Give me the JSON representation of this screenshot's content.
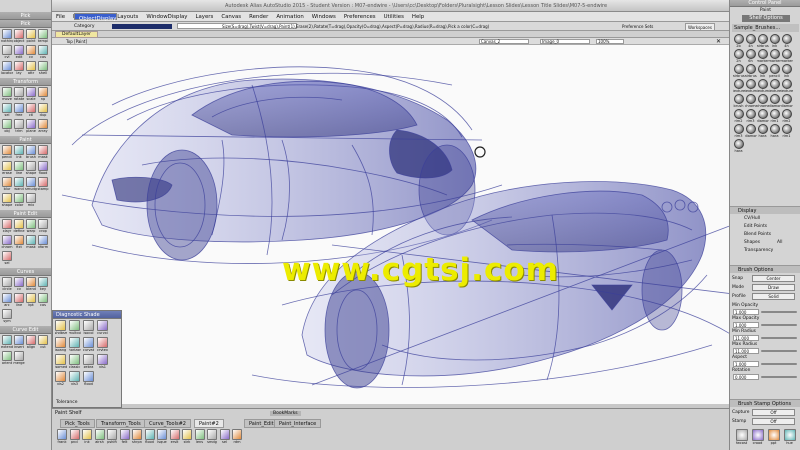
{
  "window": {
    "title": "Autodesk Alias AutoStudio 2015 - Student Version : M07-endwire - \\Users\\cc\\Desktop\\Folders\\Pluralsight\\Lesson Slides\\Lesson Title Slides\\M07-5-endwire"
  },
  "palette": {
    "header": "Pick",
    "sections": [
      {
        "title": "Pick",
        "tools": [
          "nothing",
          "object",
          "point",
          "templ",
          "cvl",
          "edit",
          "cv",
          "cos",
          "locator",
          "lay",
          "attr",
          "shell"
        ]
      },
      {
        "title": "Transform",
        "tools": [
          "move",
          "rotate",
          "scale",
          "np",
          "sel",
          "free",
          "ctl",
          "dup",
          "obj",
          "trim",
          "plane",
          "array"
        ]
      },
      {
        "title": "Paint",
        "tools": [
          "pencil",
          "ink",
          "brush",
          "mask",
          "erase",
          "line",
          "shape",
          "flood",
          "blur",
          "wand",
          "smudge",
          "stamp",
          "shape",
          "color",
          "mix"
        ]
      },
      {
        "title": "Paint Edit",
        "tools": [
          "xlayr",
          "define",
          "warp",
          "crop",
          "chrom",
          "fixt",
          "mask",
          "xform",
          "sel"
        ]
      },
      {
        "title": "Curves",
        "tools": [
          "circle",
          "cv",
          "blend",
          "key",
          "arc",
          "line",
          "kpt",
          "cos",
          "sym"
        ]
      },
      {
        "title": "Curve Edit",
        "tools": [
          "extend",
          "insert",
          "align",
          "cut",
          "orient",
          "merge"
        ]
      }
    ]
  },
  "menu": [
    "File",
    "Edit",
    "Delete",
    "Layouts",
    "ObjectDisplay",
    "WindowDisplay",
    "Layers",
    "Canvas",
    "Render",
    "Animation",
    "Windows",
    "Preferences",
    "Utilities",
    "Help"
  ],
  "menu_selected": "ObjectDisplay",
  "infobar": {
    "category": "Category",
    "hint": "Size(S=drag),Twist(V=drag),Paint(1),Erase(2),Rotate(T=drag),Opacity(O=drag),Aspect(P=drag),Radius(R=drag),Pick a color(C=drag)",
    "pref": "Preference Sets",
    "workspace": "Workspaces"
  },
  "layer": "DefaultLayer",
  "viewport": {
    "title": "Top [Paint]",
    "canvas": "Canvas_2",
    "image": "Image_0",
    "zoom": "100%"
  },
  "diagnostic": {
    "title": "Diagnostic Shade",
    "tools": [
      "shdbsm",
      "multcol",
      "isocol",
      "curvxl",
      "isoang",
      "horizon",
      "curvat",
      "crvtex",
      "isomed",
      "classic",
      "zebra",
      "vis1",
      "vis2",
      "vis3",
      "flood"
    ],
    "tolerance": "Tolerance"
  },
  "shelf": {
    "title": "Paint Shelf",
    "bookmarks": "BookMarks",
    "tabs": [
      "Pick_Tools",
      "Transform_Tools",
      "Curve_Tools#2",
      "Paint#2",
      "Paint_Edit",
      "Paint_Interface"
    ],
    "active_tab": "Paint#2",
    "tools": [
      "frank",
      "pncl",
      "ink",
      "airsh",
      "pshift",
      "felt",
      "shrpn",
      "flood",
      "lsque",
      "erslt",
      "strk",
      "lens",
      "smdg",
      "sel",
      "rdm"
    ]
  },
  "control": {
    "title": "Control Panel",
    "paint_label": "Paint",
    "shelf_options": "Shelf Options",
    "brush_set": "Sample_Brushes...",
    "brushes": [
      "2b",
      "4h",
      "airbrush",
      "ink",
      "4h",
      "2h",
      "6h",
      "marker",
      "marker",
      "marker",
      "airbrush",
      "airbrush",
      "ink",
      "pencil",
      "ink",
      "texture",
      "textum",
      "textum",
      "texture",
      "texture",
      "brush",
      "chrome",
      "chrome",
      "diamond",
      "diamond",
      "rim2",
      "rim3",
      "diamond",
      "rim1",
      "rim2",
      "rim3",
      "diamond",
      "hara",
      "hara",
      "rim1",
      "hara"
    ],
    "display": {
      "title": "Display",
      "cv_hull": "CV/Hull",
      "edit_points": "Edit Points",
      "blend_points": "Blend Points",
      "shapes": "Shapes",
      "shapes_val": "All",
      "transparency": "Transparency"
    },
    "brush_options": {
      "title": "Brush Options",
      "snap_label": "Snap",
      "snap": "Center",
      "mode_label": "Mode",
      "mode": "Draw",
      "profile_label": "Profile",
      "profile": "Solid",
      "min_opacity_label": "Min Opacity",
      "min_opacity": "1.000",
      "max_opacity_label": "Max Opacity",
      "max_opacity": "1.000",
      "min_radius_label": "Min Radius",
      "min_radius": "11.000",
      "max_radius_label": "Max Radius",
      "max_radius": "11.000",
      "aspect_label": "Aspect",
      "aspect": "1.000",
      "rotation_label": "Rotation",
      "rotation": "0.000"
    },
    "stamp": {
      "title": "Brush Stamp Options",
      "capture_label": "Capture",
      "capture": "Off",
      "stamp_label": "Stamp",
      "stamp": "Off"
    },
    "bottom_icons": [
      "fwcost",
      "crood",
      "ppt",
      "hue"
    ]
  },
  "watermark": "www.cgtsj.com",
  "colors": {
    "menu_highlight": "#3a5fcd",
    "ink": "#3b3f9a",
    "watermark": "#ecec00"
  }
}
